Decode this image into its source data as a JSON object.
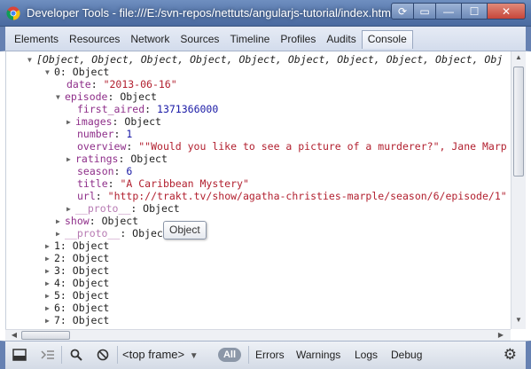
{
  "window": {
    "title": "Developer Tools - file:///E:/svn-repos/nettuts/angularjs-tutorial/index.html#/",
    "buttons": [
      "⟳",
      "▭",
      "—",
      "☐",
      "✕"
    ]
  },
  "tabs": [
    "Elements",
    "Resources",
    "Network",
    "Sources",
    "Timeline",
    "Profiles",
    "Audits",
    "Console"
  ],
  "active_tab": "Console",
  "console": {
    "summary": "[Object, Object, Object, Object, Object, Object, Object, Object, Object, Obj",
    "item0": "0: Object",
    "date_key": "date",
    "date_val": "\"2013-06-16\"",
    "episode_key": "episode",
    "episode_val": "Object",
    "first_aired_key": "first_aired",
    "first_aired_val": "1371366000",
    "images_key": "images",
    "images_val": "Object",
    "number_key": "number",
    "number_val": "1",
    "overview_key": "overview",
    "overview_val": "\"\"Would you like to see a picture of a murderer?\", Jane Marp",
    "ratings_key": "ratings",
    "ratings_val": "Object",
    "season_key": "season",
    "season_val": "6",
    "title_key": "title",
    "title_val": "\"A Caribbean Mystery\"",
    "url_key": "url",
    "url_val": "\"http://trakt.tv/show/agatha-christies-marple/season/6/episode/1\"",
    "proto_key": "__proto__",
    "proto_val": "Object",
    "show_key": "show",
    "show_val": "Object",
    "items": [
      "1: Object",
      "2: Object",
      "3: Object",
      "4: Object",
      "5: Object",
      "6: Object",
      "7: Object"
    ]
  },
  "tooltip": "Object",
  "statusbar": {
    "frame": "<top frame>",
    "all": "All",
    "filters": [
      "Errors",
      "Warnings",
      "Logs",
      "Debug"
    ]
  }
}
